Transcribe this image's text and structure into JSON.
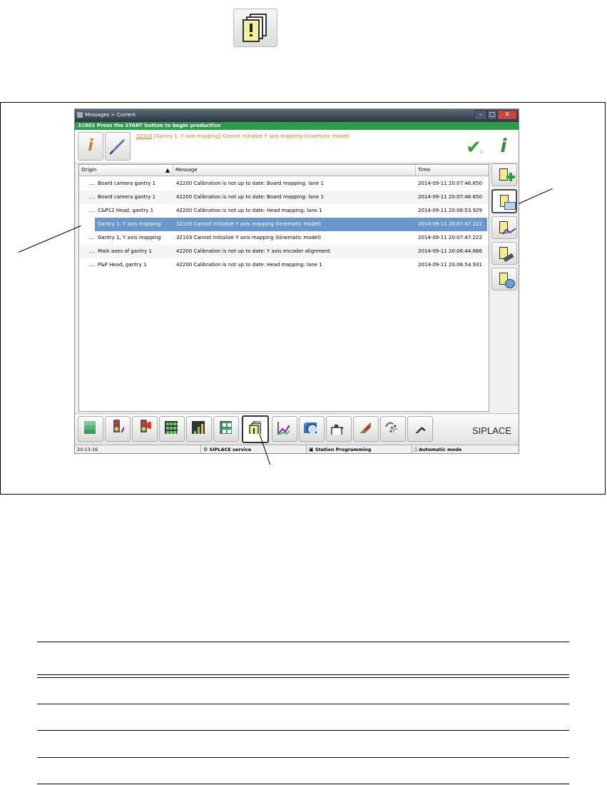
{
  "window": {
    "title": "Messages > Current",
    "status_message": "31901 Press the START button to begin production",
    "current_message_code": "32103",
    "current_message_text": " [Gantry 1, Y axis mapping] Cannot initialize Y axis mapping (kinematic model)",
    "check_count": "1"
  },
  "table": {
    "headers": [
      "Origin",
      "Message",
      "Time"
    ],
    "rows": [
      {
        "origin": "Board camera gantry 1",
        "message": "42200 Calibration is not up to date: Board mapping: lane 1",
        "time": "2014-09-11 20:07:46.850",
        "selected": false
      },
      {
        "origin": "Board camera gantry 1",
        "message": "42200 Calibration is not up to date: Board mapping: lane 1",
        "time": "2014-09-11 20:07:46.850",
        "selected": false
      },
      {
        "origin": "C&P12 Head, gantry 1",
        "message": "42200 Calibration is not up to date: Head mapping: lane 1",
        "time": "2014-09-11 20:06:53.929",
        "selected": false
      },
      {
        "origin": "Gantry 1, Y axis mapping",
        "message": "32103 Cannot initialize Y axis mapping (kinematic model)",
        "time": "2014-09-11 20:07:47.222",
        "selected": true
      },
      {
        "origin": "Gantry 1, Y axis mapping",
        "message": "32103 Cannot initialize Y axis mapping (kinematic model)",
        "time": "2014-09-11 20:07:47.222",
        "selected": false
      },
      {
        "origin": "Main axes of gantry 1",
        "message": "42200 Calibration is not up to date: Y axis encoder alignment",
        "time": "2014-09-11 20:06:44.666",
        "selected": false
      },
      {
        "origin": "P&P Head, gantry 1",
        "message": "42200 Calibration is not up to date: Head mapping: lane 1",
        "time": "2014-09-11 20:06:54.931",
        "selected": false
      }
    ]
  },
  "toolbar": {
    "brand": "SIPLACE",
    "buttons": [
      "component-stack-icon",
      "traffic-light-edit-icon",
      "traffic-light-alert-icon",
      "grid-panel-icon",
      "bar-level-icon",
      "feeder-table-icon",
      "messages-icon",
      "trend-chart-icon",
      "camera-icon",
      "oil-can-icon",
      "nozzle-icon",
      "gear-hand-icon",
      "wrench-icon"
    ]
  },
  "statusbar": {
    "time": "20:13:16",
    "service": "SIPLACE service",
    "station": "Station Programming",
    "mode": "Automatic mode"
  },
  "sidebar": {
    "buttons": [
      "message-add-icon",
      "current-messages-icon",
      "message-chart-icon",
      "message-edit-icon",
      "message-camera-icon"
    ]
  }
}
